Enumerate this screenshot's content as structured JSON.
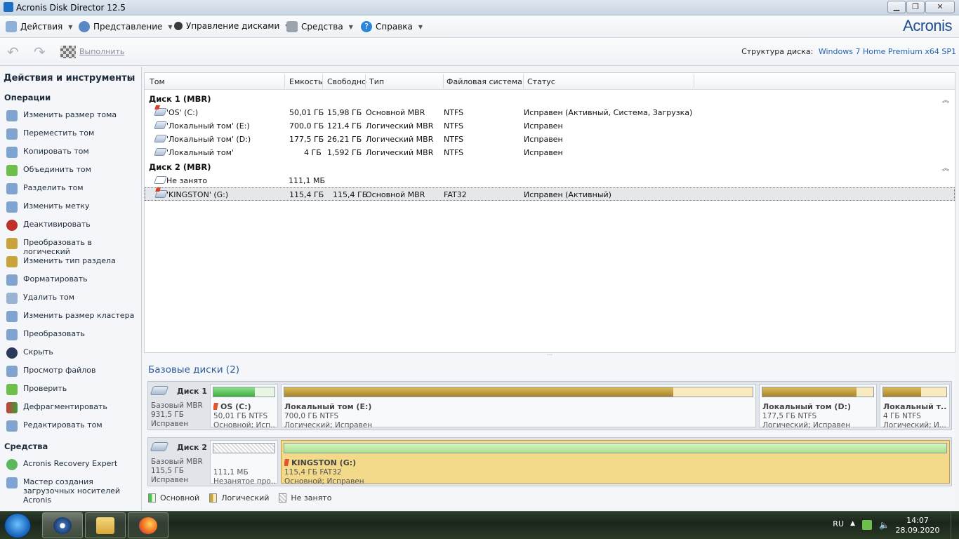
{
  "window": {
    "title": "Acronis Disk Director 12.5",
    "minimize_icon": "minimize-icon",
    "maximize_icon": "maximize-icon",
    "close_icon": "close-icon"
  },
  "menubar": {
    "items": [
      {
        "label": "Действия",
        "icon": "actions-icon"
      },
      {
        "label": "Представление",
        "icon": "view-icon"
      },
      {
        "label": "Управление дисками",
        "icon": "disk-management-icon"
      },
      {
        "label": "Средства",
        "icon": "tools-icon"
      },
      {
        "label": "Справка",
        "icon": "help-icon"
      }
    ],
    "brand": "Acronis"
  },
  "toolbar": {
    "undo_icon": "undo-icon",
    "redo_icon": "redo-icon",
    "run_label": "Выполнить",
    "disk_structure_label": "Структура диска:",
    "disk_structure_value": "Windows 7 Home Premium x64 SP1"
  },
  "sidebar": {
    "title": "Действия и инструменты",
    "operations_header": "Операции",
    "operations": [
      "Изменить размер тома",
      "Переместить том",
      "Копировать том",
      "Объединить том",
      "Разделить том",
      "Изменить метку",
      "Деактивировать",
      "Преобразовать в логический",
      "Изменить тип раздела",
      "Форматировать",
      "Удалить том",
      "Изменить размер кластера",
      "Преобразовать",
      "Скрыть",
      "Просмотр файлов",
      "Проверить",
      "Дефрагментировать",
      "Редактировать том"
    ],
    "tools_header": "Средства",
    "tools": [
      "Acronis Recovery Expert",
      "Мастер создания загрузочных носителей Acronis"
    ]
  },
  "table": {
    "columns": [
      "Том",
      "Емкость",
      "Свободно",
      "Тип",
      "Файловая система",
      "Статус"
    ],
    "groups": [
      {
        "name": "Диск 1 (MBR)",
        "rows": [
          {
            "name": "'OS' (C:)",
            "capacity": "50,01 ГБ",
            "free": "15,98 ГБ",
            "type": "Основной MBR",
            "fs": "NTFS",
            "status": "Исправен (Активный, Система, Загрузка)"
          },
          {
            "name": "'Локальный том' (E:)",
            "capacity": "700,0 ГБ",
            "free": "121,4 ГБ",
            "type": "Логический MBR",
            "fs": "NTFS",
            "status": "Исправен"
          },
          {
            "name": "'Локальный том' (D:)",
            "capacity": "177,5 ГБ",
            "free": "26,21 ГБ",
            "type": "Логический MBR",
            "fs": "NTFS",
            "status": "Исправен"
          },
          {
            "name": "'Локальный том'",
            "capacity": "4 ГБ",
            "free": "1,592 ГБ",
            "type": "Логический MBR",
            "fs": "NTFS",
            "status": "Исправен"
          }
        ]
      },
      {
        "name": "Диск 2 (MBR)",
        "rows": [
          {
            "name": "Не занято",
            "capacity": "111,1 МБ",
            "free": "",
            "type": "",
            "fs": "",
            "status": ""
          },
          {
            "name": "'KINGSTON' (G:)",
            "capacity": "115,4 ГБ",
            "free": "115,4 ГБ",
            "type": "Основной MBR",
            "fs": "FAT32",
            "status": "Исправен (Активный)"
          }
        ]
      }
    ]
  },
  "basic_disks": {
    "title": "Базовые диски (2)",
    "disks": [
      {
        "name": "Диск 1",
        "kind": "Базовый MBR",
        "size": "931,5 ГБ",
        "status": "Исправен",
        "partitions": [
          {
            "name": "OS (C:)",
            "line1": "50,01 ГБ NTFS",
            "line2": "Основной; Исп...",
            "used_fraction": 0.68,
            "kind": "primary",
            "flag": true
          },
          {
            "name": "Локальный том (E:)",
            "line1": "700,0 ГБ NTFS",
            "line2": "Логический; Исправен",
            "used_fraction": 0.83,
            "kind": "logical",
            "flag": false
          },
          {
            "name": "Локальный том (D:)",
            "line1": "177,5 ГБ NTFS",
            "line2": "Логический; Исправен",
            "used_fraction": 0.85,
            "kind": "logical",
            "flag": false
          },
          {
            "name": "Локальный т...",
            "line1": "4 ГБ NTFS",
            "line2": "Логический; И...",
            "used_fraction": 0.6,
            "kind": "logical",
            "flag": false
          }
        ]
      },
      {
        "name": "Диск 2",
        "kind": "Базовый MBR",
        "size": "115,5 ГБ",
        "status": "Исправен",
        "partitions": [
          {
            "name": "",
            "line1": "111,1 МБ",
            "line2": "Незанятое про...",
            "used_fraction": 0,
            "kind": "unallocated",
            "flag": false
          },
          {
            "name": "KINGSTON (G:)",
            "line1": "115,4 ГБ FAT32",
            "line2": "Основной; Исправен",
            "used_fraction": 0.0,
            "kind": "primary-selected",
            "flag": true
          }
        ]
      }
    ],
    "legend": [
      "Основной",
      "Логический",
      "Не занято"
    ]
  },
  "colors": {
    "primary_fill": "#4fc24f",
    "logical_fill": "#c9a43a",
    "logical_empty": "#f7ebbf",
    "selected_bg": "#f3d98a",
    "accent": "#2d5d9c"
  },
  "taskbar": {
    "lang": "RU",
    "time": "14:07",
    "date": "28.09.2020",
    "apps": [
      "acronis-taskbar-icon",
      "explorer-taskbar-icon",
      "firefox-taskbar-icon"
    ]
  }
}
